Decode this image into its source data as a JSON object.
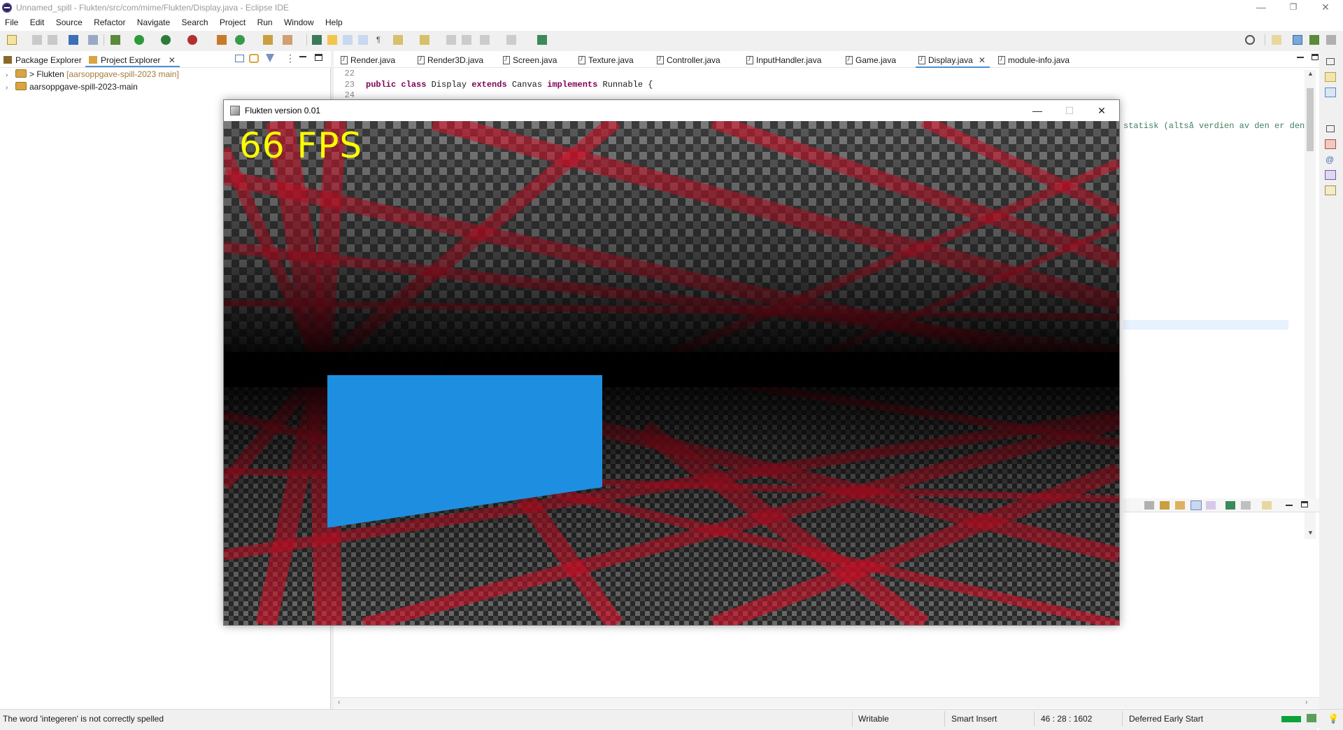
{
  "window": {
    "title": "Unnamed_spill - Flukten/src/com/mime/Flukten/Display.java - Eclipse IDE",
    "minimize": "—",
    "restore": "❐",
    "close": "✕"
  },
  "menu": [
    "File",
    "Edit",
    "Source",
    "Refactor",
    "Navigate",
    "Search",
    "Project",
    "Run",
    "Window",
    "Help"
  ],
  "left_view": {
    "tabs": [
      {
        "label": "Package Explorer",
        "icon": "package-explorer-icon"
      },
      {
        "label": "Project Explorer",
        "icon": "project-explorer-icon",
        "active": true
      }
    ],
    "tree": [
      {
        "prefix": "> ",
        "label": "Flukten",
        "decoration": " [aarsoppgave-spill-2023 main]"
      },
      {
        "prefix": "",
        "label": "aarsoppgave-spill-2023-main",
        "decoration": ""
      }
    ]
  },
  "editor": {
    "tabs": [
      {
        "label": "Render.java"
      },
      {
        "label": "Render3D.java"
      },
      {
        "label": "Screen.java"
      },
      {
        "label": "Texture.java"
      },
      {
        "label": "Controller.java"
      },
      {
        "label": "InputHandler.java"
      },
      {
        "label": "Game.java"
      },
      {
        "label": "Display.java",
        "active": true
      },
      {
        "label": "module-info.java"
      }
    ],
    "lines": {
      "l22": "22",
      "l23": "23",
      "l24": "24",
      "code_kw1": "public",
      "code_kw2": "class",
      "code_name": " Display ",
      "code_kw3": "extends",
      "code_super": " Canvas ",
      "code_kw4": "implements",
      "code_iface": " Runnable {",
      "comment_tail": "statisk (altså verdien av den er den"
    }
  },
  "game_window": {
    "title": "Flukten version 0.01",
    "fps_text": "66 FPS",
    "minimize": "—",
    "maximize": "☐",
    "close": "✕",
    "colors": {
      "floor_red": "#e0102a",
      "block_blue": "#1e8fe0",
      "fps_yellow": "#ffff00"
    }
  },
  "status": {
    "message": "The word 'integeren' is not correctly spelled",
    "mode": "Writable",
    "insert": "Smart Insert",
    "position": "46 : 28 : 1602",
    "task": "Deferred Early Start"
  }
}
